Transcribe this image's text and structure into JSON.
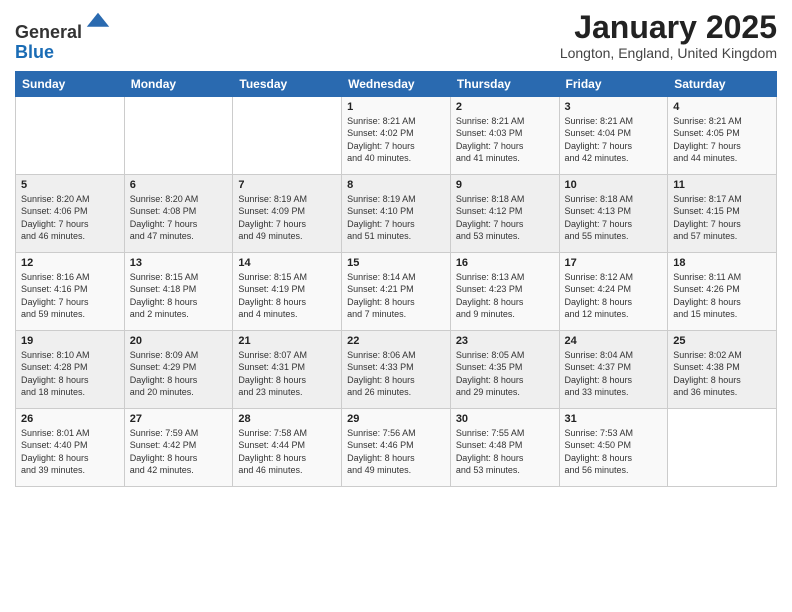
{
  "header": {
    "logo_line1": "General",
    "logo_line2": "Blue",
    "month_title": "January 2025",
    "location": "Longton, England, United Kingdom"
  },
  "days_of_week": [
    "Sunday",
    "Monday",
    "Tuesday",
    "Wednesday",
    "Thursday",
    "Friday",
    "Saturday"
  ],
  "weeks": [
    [
      {
        "day": "",
        "info": ""
      },
      {
        "day": "",
        "info": ""
      },
      {
        "day": "",
        "info": ""
      },
      {
        "day": "1",
        "info": "Sunrise: 8:21 AM\nSunset: 4:02 PM\nDaylight: 7 hours\nand 40 minutes."
      },
      {
        "day": "2",
        "info": "Sunrise: 8:21 AM\nSunset: 4:03 PM\nDaylight: 7 hours\nand 41 minutes."
      },
      {
        "day": "3",
        "info": "Sunrise: 8:21 AM\nSunset: 4:04 PM\nDaylight: 7 hours\nand 42 minutes."
      },
      {
        "day": "4",
        "info": "Sunrise: 8:21 AM\nSunset: 4:05 PM\nDaylight: 7 hours\nand 44 minutes."
      }
    ],
    [
      {
        "day": "5",
        "info": "Sunrise: 8:20 AM\nSunset: 4:06 PM\nDaylight: 7 hours\nand 46 minutes."
      },
      {
        "day": "6",
        "info": "Sunrise: 8:20 AM\nSunset: 4:08 PM\nDaylight: 7 hours\nand 47 minutes."
      },
      {
        "day": "7",
        "info": "Sunrise: 8:19 AM\nSunset: 4:09 PM\nDaylight: 7 hours\nand 49 minutes."
      },
      {
        "day": "8",
        "info": "Sunrise: 8:19 AM\nSunset: 4:10 PM\nDaylight: 7 hours\nand 51 minutes."
      },
      {
        "day": "9",
        "info": "Sunrise: 8:18 AM\nSunset: 4:12 PM\nDaylight: 7 hours\nand 53 minutes."
      },
      {
        "day": "10",
        "info": "Sunrise: 8:18 AM\nSunset: 4:13 PM\nDaylight: 7 hours\nand 55 minutes."
      },
      {
        "day": "11",
        "info": "Sunrise: 8:17 AM\nSunset: 4:15 PM\nDaylight: 7 hours\nand 57 minutes."
      }
    ],
    [
      {
        "day": "12",
        "info": "Sunrise: 8:16 AM\nSunset: 4:16 PM\nDaylight: 7 hours\nand 59 minutes."
      },
      {
        "day": "13",
        "info": "Sunrise: 8:15 AM\nSunset: 4:18 PM\nDaylight: 8 hours\nand 2 minutes."
      },
      {
        "day": "14",
        "info": "Sunrise: 8:15 AM\nSunset: 4:19 PM\nDaylight: 8 hours\nand 4 minutes."
      },
      {
        "day": "15",
        "info": "Sunrise: 8:14 AM\nSunset: 4:21 PM\nDaylight: 8 hours\nand 7 minutes."
      },
      {
        "day": "16",
        "info": "Sunrise: 8:13 AM\nSunset: 4:23 PM\nDaylight: 8 hours\nand 9 minutes."
      },
      {
        "day": "17",
        "info": "Sunrise: 8:12 AM\nSunset: 4:24 PM\nDaylight: 8 hours\nand 12 minutes."
      },
      {
        "day": "18",
        "info": "Sunrise: 8:11 AM\nSunset: 4:26 PM\nDaylight: 8 hours\nand 15 minutes."
      }
    ],
    [
      {
        "day": "19",
        "info": "Sunrise: 8:10 AM\nSunset: 4:28 PM\nDaylight: 8 hours\nand 18 minutes."
      },
      {
        "day": "20",
        "info": "Sunrise: 8:09 AM\nSunset: 4:29 PM\nDaylight: 8 hours\nand 20 minutes."
      },
      {
        "day": "21",
        "info": "Sunrise: 8:07 AM\nSunset: 4:31 PM\nDaylight: 8 hours\nand 23 minutes."
      },
      {
        "day": "22",
        "info": "Sunrise: 8:06 AM\nSunset: 4:33 PM\nDaylight: 8 hours\nand 26 minutes."
      },
      {
        "day": "23",
        "info": "Sunrise: 8:05 AM\nSunset: 4:35 PM\nDaylight: 8 hours\nand 29 minutes."
      },
      {
        "day": "24",
        "info": "Sunrise: 8:04 AM\nSunset: 4:37 PM\nDaylight: 8 hours\nand 33 minutes."
      },
      {
        "day": "25",
        "info": "Sunrise: 8:02 AM\nSunset: 4:38 PM\nDaylight: 8 hours\nand 36 minutes."
      }
    ],
    [
      {
        "day": "26",
        "info": "Sunrise: 8:01 AM\nSunset: 4:40 PM\nDaylight: 8 hours\nand 39 minutes."
      },
      {
        "day": "27",
        "info": "Sunrise: 7:59 AM\nSunset: 4:42 PM\nDaylight: 8 hours\nand 42 minutes."
      },
      {
        "day": "28",
        "info": "Sunrise: 7:58 AM\nSunset: 4:44 PM\nDaylight: 8 hours\nand 46 minutes."
      },
      {
        "day": "29",
        "info": "Sunrise: 7:56 AM\nSunset: 4:46 PM\nDaylight: 8 hours\nand 49 minutes."
      },
      {
        "day": "30",
        "info": "Sunrise: 7:55 AM\nSunset: 4:48 PM\nDaylight: 8 hours\nand 53 minutes."
      },
      {
        "day": "31",
        "info": "Sunrise: 7:53 AM\nSunset: 4:50 PM\nDaylight: 8 hours\nand 56 minutes."
      },
      {
        "day": "",
        "info": ""
      }
    ]
  ]
}
